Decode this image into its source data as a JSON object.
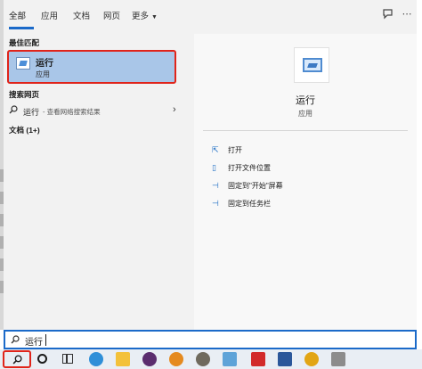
{
  "tabs": [
    {
      "label": "全部",
      "active": true
    },
    {
      "label": "应用",
      "active": false
    },
    {
      "label": "文档",
      "active": false
    },
    {
      "label": "网页",
      "active": false
    },
    {
      "label": "更多",
      "active": false
    }
  ],
  "sections": {
    "best_match": "最佳匹配",
    "web_search": "搜索网页",
    "documents": "文档 (1+)"
  },
  "best_match": {
    "name": "运行",
    "type": "应用"
  },
  "web_result": {
    "query": "运行",
    "suffix": " - 查看网络搜索结果"
  },
  "detail": {
    "name": "运行",
    "type": "应用",
    "actions": [
      {
        "icon": "open-icon",
        "label": "打开"
      },
      {
        "icon": "file-location-icon",
        "label": "打开文件位置"
      },
      {
        "icon": "pin-icon",
        "label": "固定到\"开始\"屏幕"
      },
      {
        "icon": "pin-icon",
        "label": "固定到任务栏"
      }
    ]
  },
  "search": {
    "value": "运行"
  },
  "taskbar": {
    "apps": [
      "edge-icon",
      "file-explorer-icon",
      "app-icon",
      "search-app-icon",
      "app-icon",
      "mail-icon",
      "app-icon",
      "word-icon",
      "chrome-icon",
      "app-icon"
    ]
  },
  "colors": {
    "accent": "#1b6ac9",
    "selected": "#a9c6e8",
    "highlight": "#e0241a"
  }
}
